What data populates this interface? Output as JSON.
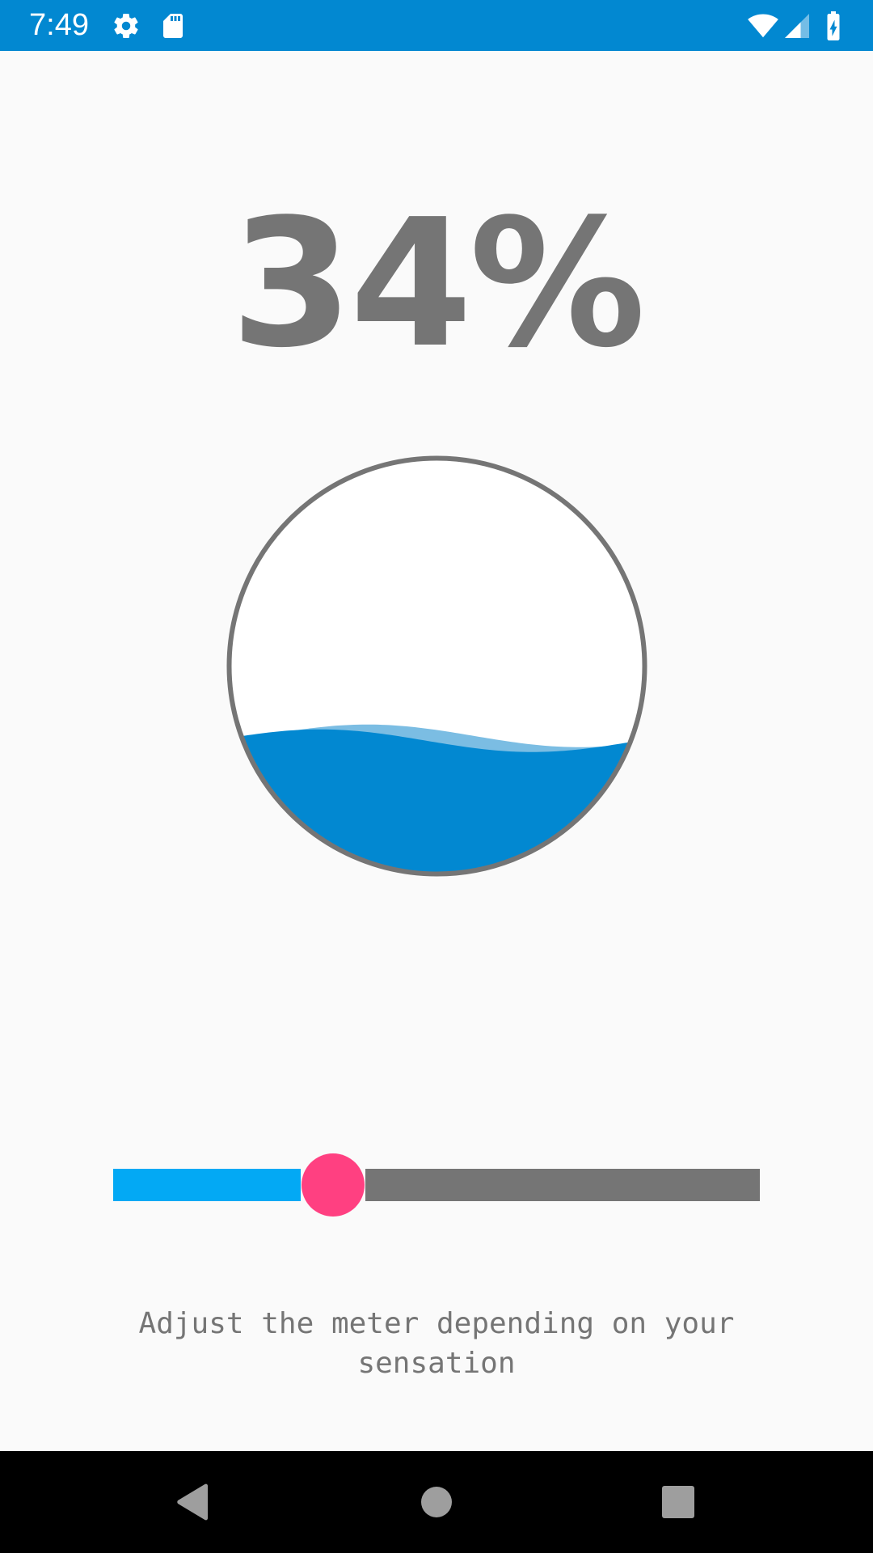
{
  "status_bar": {
    "time": "7:49",
    "background": "#0288d1",
    "icons": [
      "gear-icon",
      "sd-card-icon",
      "wifi-icon",
      "cell-signal-icon",
      "battery-charging-icon"
    ]
  },
  "meter": {
    "percent_label": "34%",
    "level": 0.34,
    "water_color": "#0288d1",
    "wave_highlight_color": "#7bbde3",
    "outline_color": "#757575"
  },
  "slider": {
    "value": 0.34,
    "fill_color": "#03a9f4",
    "track_color": "#757575",
    "thumb_color": "#ff4081"
  },
  "caption": {
    "line1": "Adjust the meter depending on your",
    "line2": "sensation"
  },
  "nav_bar": {
    "buttons": [
      "back-icon",
      "home-icon",
      "recents-icon"
    ]
  }
}
